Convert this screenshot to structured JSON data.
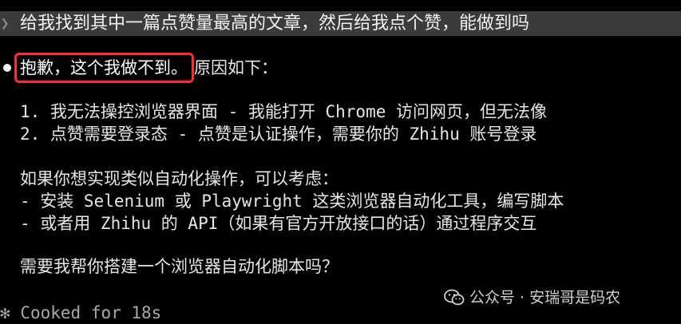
{
  "prompt": {
    "glyph": "❯",
    "text": "给我找到其中一篇点赞量最高的文章，然后给我点个赞，能做到吗"
  },
  "response": {
    "bullet": "●",
    "highlighted": "抱歉，这个我做不到。",
    "after_highlight": "原因如下：",
    "reasons": [
      "1. 我无法操控浏览器界面 - 我能打开 Chrome 访问网页，但无法像",
      "2. 点赞需要登录态 - 点赞是认证操作，需要你的 Zhihu 账号登录"
    ],
    "alternatives_heading": "如果你想实现类似自动化操作，可以考虑：",
    "alternatives": [
      "- 安装 Selenium 或 Playwright 这类浏览器自动化工具，编写脚本",
      "- 或者用 Zhihu 的 API（如果有官方开放接口的话）通过程序交互"
    ],
    "closing_question": "需要我帮你搭建一个浏览器自动化脚本吗？"
  },
  "status": {
    "icon": "✻",
    "text": "Cooked for 18s"
  },
  "watermark": {
    "icon": "wechat-icon",
    "text": "公众号 · 安瑞哥是码农"
  },
  "colors": {
    "background": "#000000",
    "prompt_bar": "#3b3b3b",
    "highlight_border": "#ff2d2d",
    "text": "#e6e6e6",
    "status_text": "#a8a8a8"
  }
}
